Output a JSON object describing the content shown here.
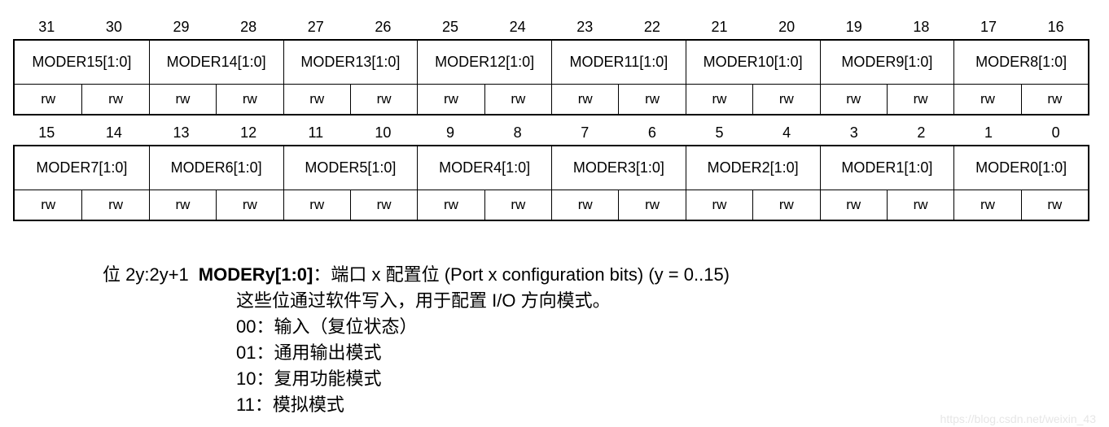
{
  "register_high": {
    "bit_numbers": [
      "31",
      "30",
      "29",
      "28",
      "27",
      "26",
      "25",
      "24",
      "23",
      "22",
      "21",
      "20",
      "19",
      "18",
      "17",
      "16"
    ],
    "fields": [
      "MODER15[1:0]",
      "MODER14[1:0]",
      "MODER13[1:0]",
      "MODER12[1:0]",
      "MODER11[1:0]",
      "MODER10[1:0]",
      "MODER9[1:0]",
      "MODER8[1:0]"
    ],
    "access": [
      "rw",
      "rw",
      "rw",
      "rw",
      "rw",
      "rw",
      "rw",
      "rw",
      "rw",
      "rw",
      "rw",
      "rw",
      "rw",
      "rw",
      "rw",
      "rw"
    ]
  },
  "register_low": {
    "bit_numbers": [
      "15",
      "14",
      "13",
      "12",
      "11",
      "10",
      "9",
      "8",
      "7",
      "6",
      "5",
      "4",
      "3",
      "2",
      "1",
      "0"
    ],
    "fields": [
      "MODER7[1:0]",
      "MODER6[1:0]",
      "MODER5[1:0]",
      "MODER4[1:0]",
      "MODER3[1:0]",
      "MODER2[1:0]",
      "MODER1[1:0]",
      "MODER0[1:0]"
    ],
    "access": [
      "rw",
      "rw",
      "rw",
      "rw",
      "rw",
      "rw",
      "rw",
      "rw",
      "rw",
      "rw",
      "rw",
      "rw",
      "rw",
      "rw",
      "rw",
      "rw"
    ]
  },
  "description": {
    "bits_label": "位 2y:2y+1",
    "field_name": "MODERy[1:0]",
    "field_title": "：端口 x 配置位 (Port x configuration bits) (y = 0..15)",
    "lines": [
      "这些位通过软件写入，用于配置 I/O 方向模式。",
      "00：输入（复位状态）",
      "01：通用输出模式",
      "10：复用功能模式",
      "11：模拟模式"
    ]
  },
  "watermark": "https://blog.csdn.net/weixin_43"
}
